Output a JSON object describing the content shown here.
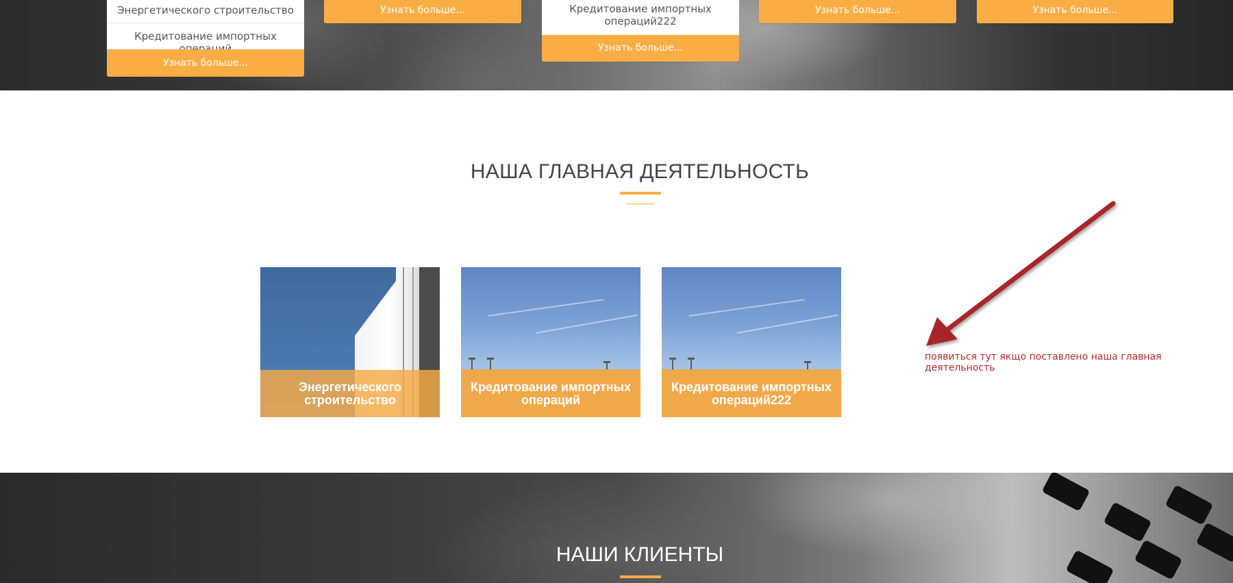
{
  "hero_cards": {
    "card1": {
      "line1": "Энергетического строительство",
      "line2": "Кредитование импортных операций",
      "button": "Узнать больше..."
    },
    "card2": {
      "button": "Узнать больше..."
    },
    "card3": {
      "line1": "Кредитование импортных операций222",
      "button": "Узнать больше..."
    },
    "card4": {
      "button": "Узнать больше..."
    },
    "card5": {
      "button": "Узнать больше..."
    }
  },
  "main_activity": {
    "title": "НАША ГЛАВНАЯ ДЕЯТЕЛЬНОСТЬ",
    "tiles": [
      {
        "label": "Энергетического строительство"
      },
      {
        "label": "Кредитование импортных операций"
      },
      {
        "label": "Кредитование импортных операций222"
      }
    ]
  },
  "annotation": {
    "text": "появиться тут якщо поставлено наша главная деятельность",
    "color": "#b22a2a"
  },
  "clients": {
    "title": "НАШИ КЛИЕНТЫ"
  },
  "colors": {
    "accent": "#fbad45",
    "overlay": "#f5aa46",
    "heading": "#444444"
  }
}
